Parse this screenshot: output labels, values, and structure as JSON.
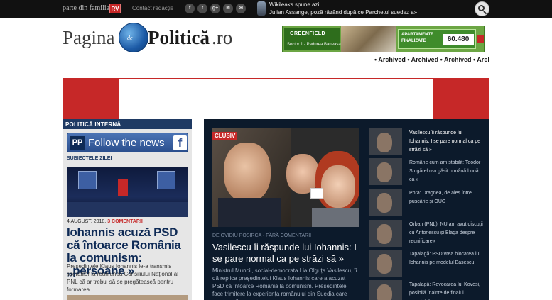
{
  "topbar": {
    "family_label": "parte din familia",
    "family_logo": "RV",
    "contact_label": "Contact redacție",
    "social_icons": [
      {
        "name": "facebook-icon",
        "glyph": "f"
      },
      {
        "name": "twitter-icon",
        "glyph": "t"
      },
      {
        "name": "google-plus-icon",
        "glyph": "g+"
      },
      {
        "name": "rss-icon",
        "glyph": "≋"
      },
      {
        "name": "email-icon",
        "glyph": "✉"
      }
    ],
    "wikileaks_title": "Wikileaks spune azi:",
    "wikileaks_text": "Julian Assange, poză râzând după ce Parchetul suedez a»"
  },
  "logo": {
    "part1": "Pagina",
    "part_de": "de",
    "part2": "Politică",
    "part3": ".ro"
  },
  "ad": {
    "brand": "GREENFIELD",
    "location": "Sector 1 - Padurea Baneasa",
    "apartments_label": "APARTAMENTE FINALIZATE",
    "price": "60.480"
  },
  "archive_text": "• Archived • Archived • Archived • Archived",
  "left": {
    "section_title": "POLITICĂ INTERNĂ",
    "follow_logo": "PP",
    "follow_text": "Follow the news",
    "follow_fb": "f",
    "subheading": "SUBIECTELE ZILEI",
    "date": "4 AUGUST, 2018,",
    "comments": "3 COMENTARII",
    "headline": "Iohannis acuză PSD că întoarce România la comunism: „persoane »",
    "summary": "Președintele Klaus Iohannis le-a transmis liberalilor la reuniunea Consiliului Național al PNL că ar trebui să se pregătească pentru formarea..."
  },
  "main": {
    "badge": "CLUSIV",
    "byline": "DE OVIDIU POSIRCA · FĂRĂ COMENTARII",
    "headline": "Vasilescu îi răspunde lui Iohannis: I se pare normal ca pe străzi să »",
    "summary": "Ministrul Muncii, social-democrata Lia Olguța Vasilescu, îi dă replica președintelui Klaus Iohannis care a acuzat PSD că întoarce România la comunism. Președintele face trimitere la experiența românului din Suedia care spunea că..."
  },
  "side_list": [
    {
      "text": "Vasilescu îi răspunde lui Iohannis: I se pare normal ca pe străzi să »"
    },
    {
      "text": "Române cum am stabilit: Teodor Stugărel n-a găsit o mână bună ca »"
    },
    {
      "text": "Pora: Dragnea, de ales între pușcărie și OUG"
    },
    {
      "text": "Orban (PNL): NU am avut discuții cu Antonescu și Blaga despre reunificare»"
    },
    {
      "text": "Tapalagă: PSD vrea blocarea lui Iohannis pe modelul Basescu"
    },
    {
      "text": "Tapalagă: Revocarea lui Kovesi, posibilă înainte de finalul mandatului"
    }
  ]
}
